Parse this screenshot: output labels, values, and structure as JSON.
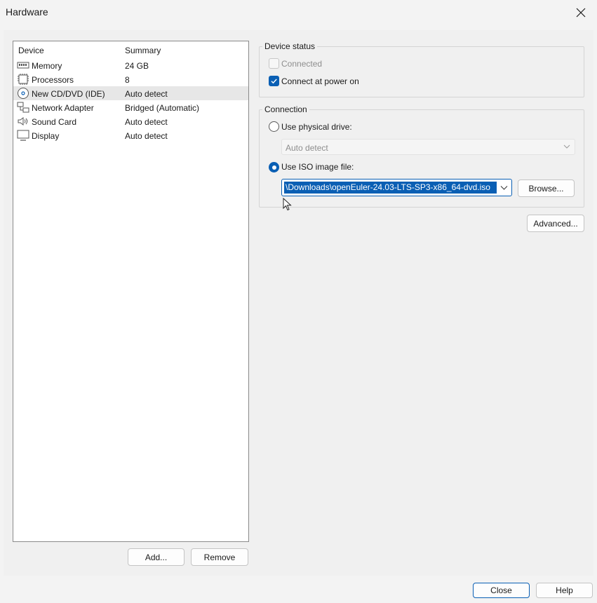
{
  "window": {
    "title": "Hardware"
  },
  "device_list": {
    "headers": {
      "device": "Device",
      "summary": "Summary"
    },
    "items": [
      {
        "name": "Memory",
        "summary": "24 GB",
        "icon": "memory-icon"
      },
      {
        "name": "Processors",
        "summary": "8",
        "icon": "processor-icon"
      },
      {
        "name": "New CD/DVD (IDE)",
        "summary": "Auto detect",
        "icon": "cd-dvd-icon",
        "selected": true
      },
      {
        "name": "Network Adapter",
        "summary": "Bridged (Automatic)",
        "icon": "network-adapter-icon"
      },
      {
        "name": "Sound Card",
        "summary": "Auto detect",
        "icon": "sound-card-icon"
      },
      {
        "name": "Display",
        "summary": "Auto detect",
        "icon": "display-icon"
      }
    ],
    "add_label": "Add...",
    "remove_label": "Remove"
  },
  "device_status": {
    "legend": "Device status",
    "connected_label": "Connected",
    "connected_checked": false,
    "connected_enabled": false,
    "power_on_label": "Connect at power on",
    "power_on_checked": true
  },
  "connection": {
    "legend": "Connection",
    "physical_label": "Use physical drive:",
    "physical_selected": false,
    "physical_value": "Auto detect",
    "iso_label": "Use ISO image file:",
    "iso_selected": true,
    "iso_value": "\\Downloads\\openEuler-24.03-LTS-SP3-x86_64-dvd.iso",
    "browse_label": "Browse..."
  },
  "advanced_label": "Advanced...",
  "footer": {
    "close_label": "Close",
    "help_label": "Help"
  },
  "colors": {
    "accent": "#0a5fb4",
    "selected_row": "#e7e7e7"
  }
}
